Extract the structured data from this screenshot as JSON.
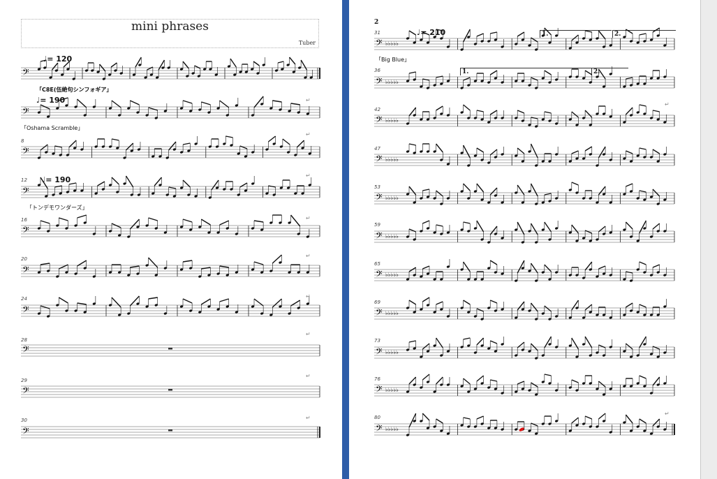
{
  "title": "mini phrases",
  "composer": "Tuber",
  "return_mark": "↵",
  "left_page": {
    "tempos": [
      {
        "label": "♩= 120"
      },
      {
        "label": "♩= 190"
      },
      {
        "label": "♩= 190"
      }
    ],
    "rehearsals": [
      {
        "text": "「C8E(伍絶句シンフォギア」"
      },
      {
        "text": "「Oshama Scramble」"
      },
      {
        "text": "「トンデモワンダーズ」"
      }
    ],
    "measure_numbers": [
      "8",
      "12",
      "16",
      "20",
      "24",
      "28",
      "29",
      "30"
    ]
  },
  "right_page": {
    "page_number": "2",
    "tempos": [
      {
        "label": "♩= 210"
      }
    ],
    "rehearsals": [
      {
        "text": "「Big Blue」"
      }
    ],
    "voltas": [
      "1.",
      "2.",
      "1.",
      "2."
    ],
    "measure_numbers": [
      "31",
      "36",
      "42",
      "47",
      "53",
      "59",
      "65",
      "69",
      "73",
      "76",
      "80"
    ]
  },
  "colors": {
    "divider": "#2e5da8",
    "highlight_note": "#dd1111",
    "staff": "#333333"
  }
}
